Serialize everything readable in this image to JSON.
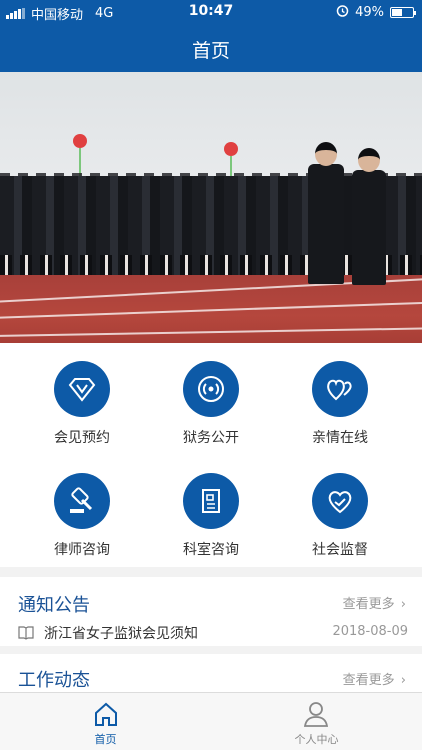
{
  "status_bar": {
    "carrier": "中国移动",
    "network": "4G",
    "time": "10:47",
    "battery": "49%",
    "battery_level": 0.49
  },
  "header": {
    "title": "首页"
  },
  "colors": {
    "primary": "#0d5aa7",
    "section_title": "#1a5296",
    "muted": "#999999"
  },
  "services": [
    {
      "label": "会见预约",
      "icon": "diamond-v-icon"
    },
    {
      "label": "狱务公开",
      "icon": "broadcast-icon"
    },
    {
      "label": "亲情在线",
      "icon": "hearts-icon"
    },
    {
      "label": "律师咨询",
      "icon": "gavel-icon"
    },
    {
      "label": "科室咨询",
      "icon": "document-icon"
    },
    {
      "label": "社会监督",
      "icon": "heart-hand-icon"
    }
  ],
  "notices": {
    "title": "通知公告",
    "more": "查看更多",
    "items": [
      {
        "title": "浙江省女子监狱会见须知",
        "date": "2018-08-09",
        "icon": "book-icon"
      }
    ]
  },
  "news": {
    "title": "工作动态",
    "more": "查看更多"
  },
  "tabbar": {
    "items": [
      {
        "label": "首页",
        "icon": "home-icon",
        "active": true
      },
      {
        "label": "个人中心",
        "icon": "person-icon",
        "active": false
      }
    ]
  }
}
